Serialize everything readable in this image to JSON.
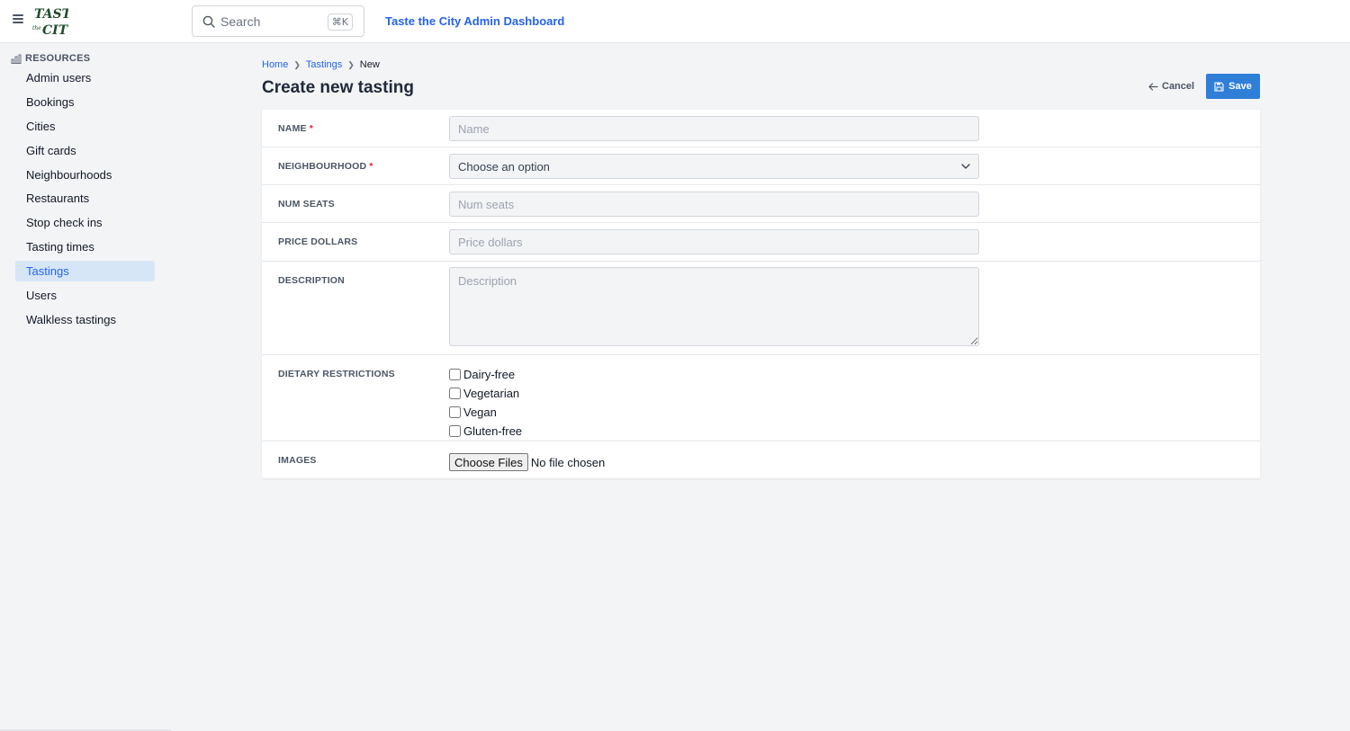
{
  "header": {
    "logo_text": "TASTE the CITY",
    "search_placeholder": "Search",
    "search_shortcut": "⌘K",
    "app_title": "Taste the City Admin Dashboard"
  },
  "sidebar": {
    "section_label": "RESOURCES",
    "items": [
      {
        "label": "Admin users",
        "active": false
      },
      {
        "label": "Bookings",
        "active": false
      },
      {
        "label": "Cities",
        "active": false
      },
      {
        "label": "Gift cards",
        "active": false
      },
      {
        "label": "Neighbourhoods",
        "active": false
      },
      {
        "label": "Restaurants",
        "active": false
      },
      {
        "label": "Stop check ins",
        "active": false
      },
      {
        "label": "Tasting times",
        "active": false
      },
      {
        "label": "Tastings",
        "active": true
      },
      {
        "label": "Users",
        "active": false
      },
      {
        "label": "Walkless tastings",
        "active": false
      }
    ]
  },
  "breadcrumb": {
    "home": "Home",
    "section": "Tastings",
    "current": "New"
  },
  "page": {
    "title": "Create new tasting",
    "cancel_label": "Cancel",
    "save_label": "Save"
  },
  "form": {
    "name": {
      "label": "NAME",
      "required_mark": "*",
      "placeholder": "Name",
      "value": ""
    },
    "neighbourhood": {
      "label": "NEIGHBOURHOOD",
      "required_mark": "*",
      "selected": "Choose an option"
    },
    "num_seats": {
      "label": "NUM SEATS",
      "placeholder": "Num seats",
      "value": ""
    },
    "price_dollars": {
      "label": "PRICE DOLLARS",
      "placeholder": "Price dollars",
      "value": ""
    },
    "description": {
      "label": "DESCRIPTION",
      "placeholder": "Description",
      "value": ""
    },
    "dietary": {
      "label": "DIETARY RESTRICTIONS",
      "options": [
        {
          "label": "Dairy-free",
          "checked": false
        },
        {
          "label": "Vegetarian",
          "checked": false
        },
        {
          "label": "Vegan",
          "checked": false
        },
        {
          "label": "Gluten-free",
          "checked": false
        }
      ]
    },
    "images": {
      "label": "IMAGES",
      "button_label": "Choose Files",
      "status": "No file chosen"
    }
  },
  "colors": {
    "accent": "#2563eb",
    "save_button": "#2f7fd8",
    "active_nav_bg": "#d6e6f7",
    "required": "#dc2626",
    "logo": "#1f4d2b"
  }
}
